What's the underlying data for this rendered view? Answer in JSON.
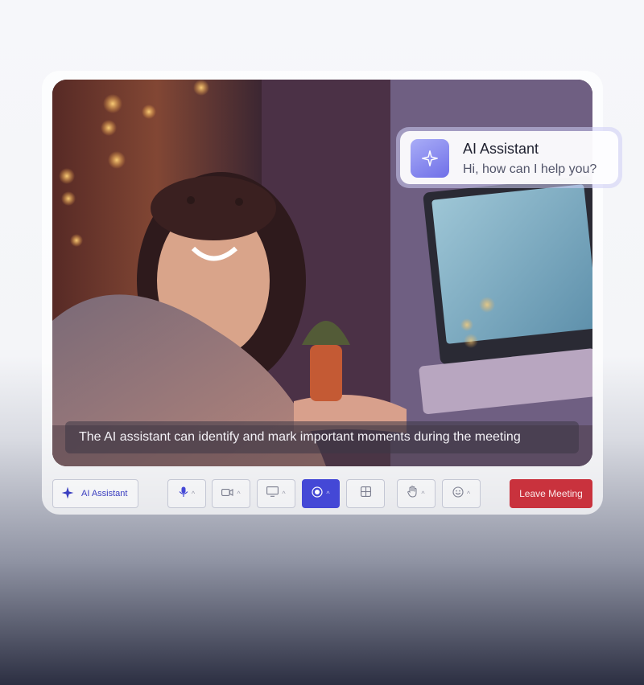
{
  "video": {
    "caption": "The AI assistant can identify and mark important moments during the meeting"
  },
  "ai_popup": {
    "title": "AI Assistant",
    "message": "Hi, how can I help you?",
    "icon": "sparkle-icon"
  },
  "toolbar": {
    "ai_assistant_label": "AI Assistant",
    "leave_label": "Leave Meeting",
    "controls": [
      {
        "icon": "microphone-icon",
        "has_menu": true
      },
      {
        "icon": "camera-icon",
        "has_menu": true
      },
      {
        "icon": "screen-share-icon",
        "has_menu": true
      },
      {
        "icon": "record-icon",
        "has_menu": true,
        "active": true
      },
      {
        "icon": "grid-layout-icon",
        "has_menu": false
      },
      {
        "icon": "raise-hand-icon",
        "has_menu": true
      },
      {
        "icon": "emoji-icon",
        "has_menu": true
      }
    ]
  },
  "colors": {
    "accent": "#4448d6",
    "leave": "#c9323d",
    "ai_gradient_start": "#a9adf7",
    "ai_gradient_end": "#6f6fe8"
  }
}
